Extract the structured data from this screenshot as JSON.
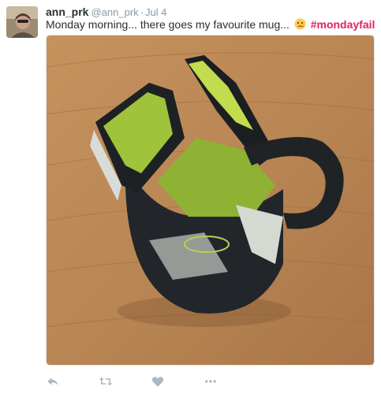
{
  "tweet": {
    "fullname": "ann_prk",
    "handle": "@ann_prk",
    "separator": "·",
    "timestamp": "Jul 4",
    "text_before": "Monday morning... there goes my favourite mug...",
    "emoji": "crying-face",
    "hashtag": "#mondayfail",
    "media_subject": "broken-mug-photo"
  },
  "actions": [
    {
      "icon": "reply-icon"
    },
    {
      "icon": "retweet-icon"
    },
    {
      "icon": "like-icon"
    },
    {
      "icon": "more-icon"
    }
  ],
  "colors": {
    "name": "#292f33",
    "meta": "#8899a6",
    "hashtag": "#e0245e",
    "action": "#aab8c2"
  }
}
